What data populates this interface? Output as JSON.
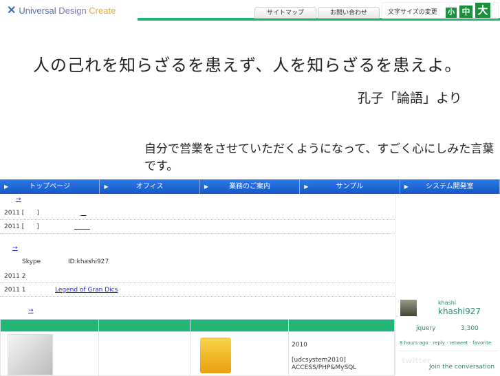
{
  "header": {
    "logo": {
      "u": "Universal ",
      "d": "Design ",
      "c": "Create"
    },
    "links": [
      "サイトマップ",
      "お問い合わせ"
    ],
    "font_size_label": "文字サイズの変更",
    "font_sizes": [
      "小",
      "中",
      "大"
    ]
  },
  "hero": {
    "quote": "人の己れを知らざるを患えず、人を知らざるを患えよ。",
    "source": "孔子「論語」より",
    "comment": "自分で営業をさせていただくようになって、すごく心にしみた言葉です。"
  },
  "nav": [
    "トップページ",
    "オフィス",
    "業務のご案内",
    "サンプル",
    "システム開発室"
  ],
  "main": {
    "news1": {
      "arrow": "→",
      "rows": [
        "2011 [　　]",
        "2011 [　　]"
      ]
    },
    "news2": {
      "arrow": "→",
      "skype": "Skype",
      "skype_id": "ID:khashi927",
      "rows": [
        {
          "date": "2011 2",
          "link": ""
        },
        {
          "date": "2011 1",
          "link": "Legend of Gran Dics"
        }
      ]
    },
    "products": {
      "arrow": "→",
      "col4": {
        "year": "2010",
        "name": "[udcsystem2010]",
        "tech": "ACCESS/PHP&MySQL"
      }
    }
  },
  "twitter": {
    "name": "khashi",
    "handle": "khashi927",
    "text1": "jquery",
    "text2": "3,300",
    "time": "8 hours ago",
    "actions": [
      "reply",
      "retweet",
      "favorite"
    ],
    "brand": "twitter",
    "join": "Join the conversation"
  }
}
